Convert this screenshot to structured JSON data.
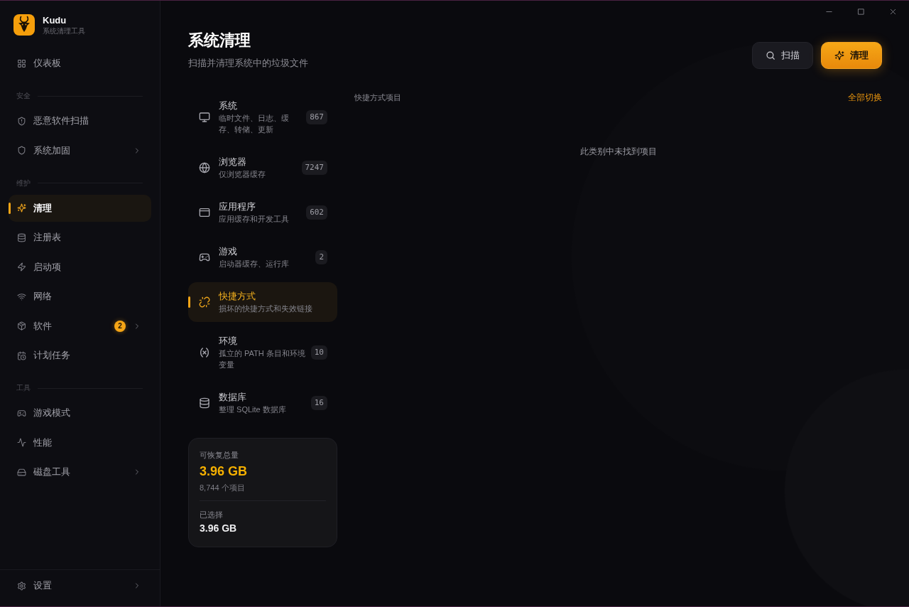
{
  "app": {
    "name": "Kudu",
    "tagline": "系统清理工具"
  },
  "sidebar": {
    "sections": [
      {
        "items": [
          {
            "label": "仪表板",
            "selected": false,
            "submenu": false
          }
        ]
      },
      {
        "heading": "安全",
        "items": [
          {
            "label": "恶意软件扫描",
            "selected": false,
            "submenu": false
          },
          {
            "label": "系统加固",
            "selected": false,
            "submenu": true
          }
        ]
      },
      {
        "heading": "维护",
        "items": [
          {
            "label": "清理",
            "selected": true,
            "submenu": false
          },
          {
            "label": "注册表",
            "selected": false,
            "submenu": false
          },
          {
            "label": "启动项",
            "selected": false,
            "submenu": false
          },
          {
            "label": "网络",
            "selected": false,
            "submenu": false
          },
          {
            "label": "软件",
            "selected": false,
            "submenu": true,
            "badge": "2"
          },
          {
            "label": "计划任务",
            "selected": false,
            "submenu": false
          }
        ]
      },
      {
        "heading": "工具",
        "items": [
          {
            "label": "游戏模式",
            "selected": false,
            "submenu": false
          },
          {
            "label": "性能",
            "selected": false,
            "submenu": false
          },
          {
            "label": "磁盘工具",
            "selected": false,
            "submenu": true
          }
        ]
      }
    ],
    "footer": {
      "label": "设置",
      "submenu": true
    }
  },
  "header": {
    "title": "系统清理",
    "subtitle": "扫描并清理系统中的垃圾文件"
  },
  "actions": [
    {
      "label": "扫描",
      "kind": "secondary"
    },
    {
      "label": "清理",
      "kind": "primary"
    }
  ],
  "categories": [
    {
      "title": "系统",
      "description": "临时文件、日志、缓存、转储、更新",
      "count": "867",
      "selected": false
    },
    {
      "title": "浏览器",
      "description": "仅浏览器缓存",
      "count": "7247",
      "selected": false
    },
    {
      "title": "应用程序",
      "description": "应用缓存和开发工具",
      "count": "602",
      "selected": false
    },
    {
      "title": "游戏",
      "description": "启动器缓存、运行库",
      "count": "2",
      "selected": false
    },
    {
      "title": "快捷方式",
      "description": "损坏的快捷方式和失效链接",
      "selected": true
    },
    {
      "title": "环境",
      "description": "孤立的 PATH 条目和环境变量",
      "count": "10",
      "selected": false
    },
    {
      "title": "数据库",
      "description": "整理 SQLite 数据库",
      "count": "16",
      "selected": false
    }
  ],
  "summary": {
    "total_label": "可恢复总量",
    "total_size": "3.96 GB",
    "item_count": "8,744 个项目",
    "selected_label": "已选择",
    "selected_size": "3.96 GB"
  },
  "panel": {
    "heading": "快捷方式项目",
    "toggle_all": "全部切换",
    "empty_message": "此类别中未找到项目"
  }
}
